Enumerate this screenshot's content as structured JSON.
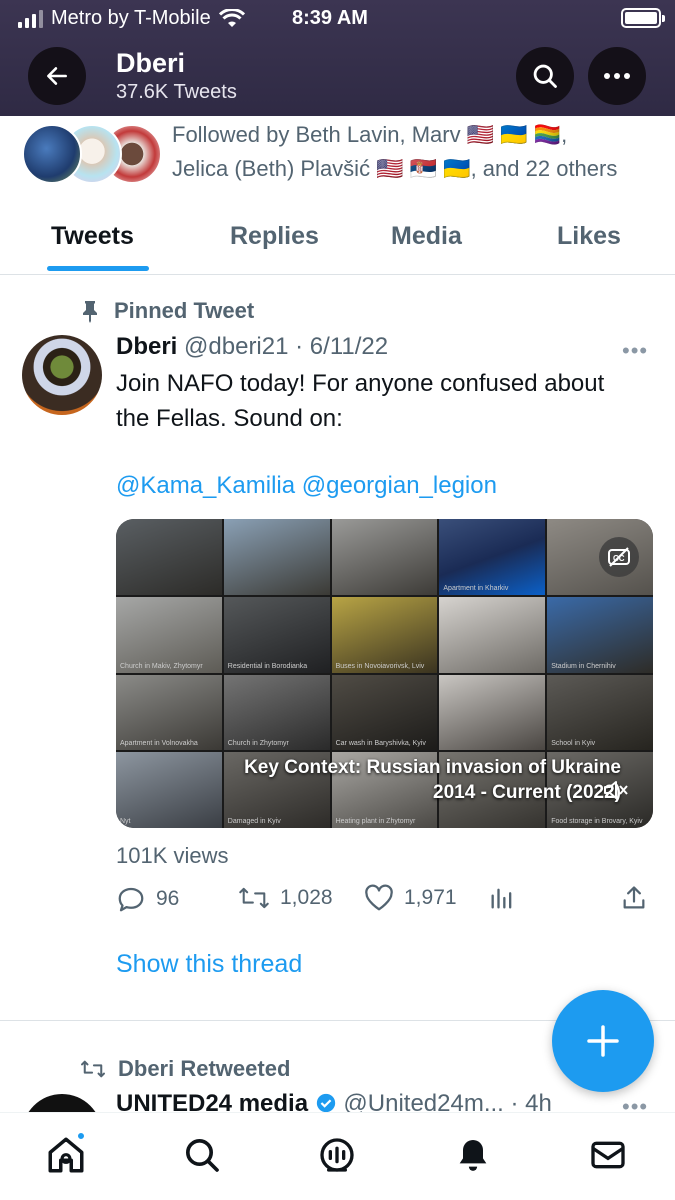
{
  "status_bar": {
    "carrier": "Metro by T-Mobile",
    "time": "8:39 AM",
    "battery_level": 1.0
  },
  "header": {
    "title": "Dberi",
    "subtitle": "37.6K Tweets",
    "back_icon": "arrow-left-icon",
    "search_icon": "search-icon",
    "more_icon": "more-horizontal-icon"
  },
  "followed_by": {
    "line1": "Followed by Beth Lavin, Marv 🇺🇸 🇺🇦 🏳️‍🌈,",
    "line2": "Jelica (Beth) Plavšić 🇺🇸 🇷🇸 🇺🇦, and 22 others"
  },
  "tabs": [
    {
      "label": "Tweets",
      "active": true
    },
    {
      "label": "Replies",
      "active": false
    },
    {
      "label": "Media",
      "active": false
    },
    {
      "label": "Likes",
      "active": false
    }
  ],
  "pinned_tweet": {
    "pinned_label": "Pinned Tweet",
    "name": "Dberi",
    "handle": "@dberi21",
    "date": "6/11/22",
    "more": "•••",
    "text": "Join NAFO today! For anyone confused about the Fellas. Sound on:",
    "mentions": "@Kama_Kamilia @georgian_legion",
    "media": {
      "caption_line1": "Key Context: Russian invasion of Ukraine",
      "caption_line2": "2014 - Current (2022)",
      "cell_labels": [
        "",
        "",
        "",
        "Apartment in Kharkiv",
        "",
        "Church in Makiv, Zhytomyr",
        "Residential in Borodianka",
        "Buses in Novoiavorivsk, Lviv",
        "",
        "Stadium in Chernihiv",
        "Apartment in Volnovakha",
        "Church in Zhytomyr",
        "Car wash in Baryshivka, Kyiv",
        "",
        "School in Kyiv",
        "Nyt",
        "Damaged in Kyiv",
        "Heating plant in Zhytomyr",
        "",
        "Food storage in Brovary, Kyiv"
      ]
    },
    "views": "101K views",
    "replies": "96",
    "retweets": "1,028",
    "likes": "1,971",
    "show_thread": "Show this thread"
  },
  "retweet": {
    "label": "Dberi Retweeted",
    "name": "UNITED24 media",
    "handle": "@United24m...",
    "time": "· 4h",
    "more": "•••"
  },
  "bottom_nav": [
    "home-icon",
    "search-icon",
    "spaces-icon",
    "notifications-icon",
    "messages-icon"
  ],
  "colors": {
    "accent": "#1d9bf0",
    "header_bg": "#35304a",
    "muted": "#536471"
  }
}
